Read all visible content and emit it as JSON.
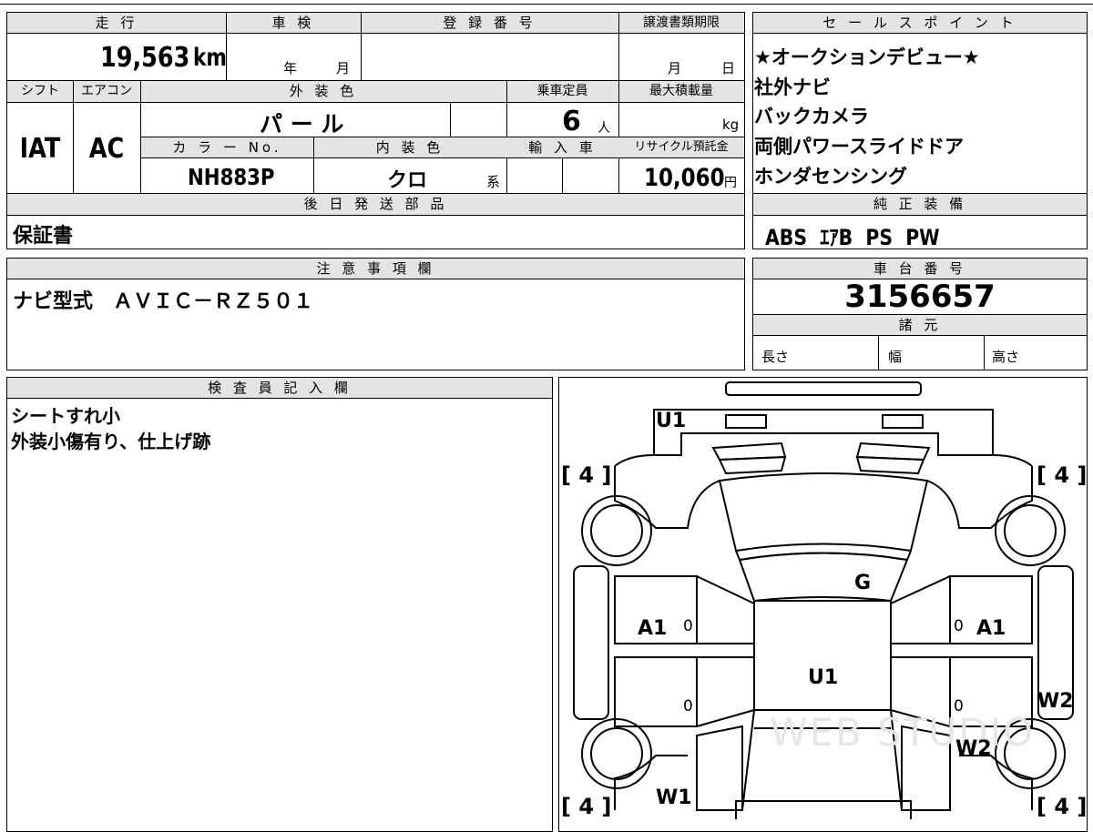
{
  "mileage": {
    "header": "走 行",
    "value": "19,563",
    "unit": "km"
  },
  "inspection": {
    "header": "車 検",
    "year_label": "年",
    "month_label": "月"
  },
  "registration": {
    "header": "登 録 番 号",
    "value": ""
  },
  "transfer_deadline": {
    "header": "譲渡書類期限",
    "month_label": "月",
    "day_label": "日"
  },
  "shift": {
    "header": "シフト",
    "value": "IAT"
  },
  "aircon": {
    "header": "エアコン",
    "value": "AC"
  },
  "exterior_color": {
    "header": "外 装 色",
    "value": "パ ー ル"
  },
  "capacity": {
    "header": "乗車定員",
    "value": "6",
    "unit": "人"
  },
  "max_load": {
    "header": "最大積載量",
    "value": "",
    "unit": "kg"
  },
  "color_no": {
    "header": "カ ラ ー No.",
    "value": "NH883P"
  },
  "interior_color": {
    "header": "内 装 色",
    "value": "クロ",
    "unit": "系"
  },
  "imported": {
    "header": "輸 入 車"
  },
  "recycle": {
    "header": "リサイクル預託金",
    "value": "10,060",
    "unit": "円"
  },
  "later_parts": {
    "header": "後 日 発 送 部 品",
    "value": "保証書"
  },
  "sales_points": {
    "header": "セ ー ル ス ポ イ ン ト",
    "items": [
      "★オークションデビュー★",
      "社外ナビ",
      "バックカメラ",
      "両側パワースライドドア",
      "ホンダセンシング"
    ]
  },
  "standard_equipment": {
    "header": "純 正 装 備",
    "value": "ABS  ｴｱB  PS  PW"
  },
  "notes": {
    "header": "注 意 事 項 欄",
    "value": "ナビ型式　ＡＶＩＣ－ＲＺ５０１"
  },
  "chassis_number": {
    "header": "車 台 番 号",
    "value": "3156657"
  },
  "specs": {
    "header": "諸 元",
    "length_label": "長さ",
    "width_label": "幅",
    "height_label": "高さ"
  },
  "inspector": {
    "header": "検 査 員 記 入 欄",
    "lines": [
      "シートすれ小",
      "外装小傷有り、仕上げ跡"
    ]
  },
  "diagram": {
    "tire_tl": "[ 4 ]",
    "tire_tr": "[ 4 ]",
    "tire_bl": "[ 4 ]",
    "tire_br": "[ 4 ]",
    "front_bumper": "U1",
    "hood": "G",
    "left_front_door": "A1",
    "right_front_door": "A1",
    "roof": "U1",
    "right_rear_door": "W2",
    "right_quarter": "W2",
    "left_rear": "W1",
    "zero_mark": "0",
    "watermark": "WEB STUDIO"
  }
}
